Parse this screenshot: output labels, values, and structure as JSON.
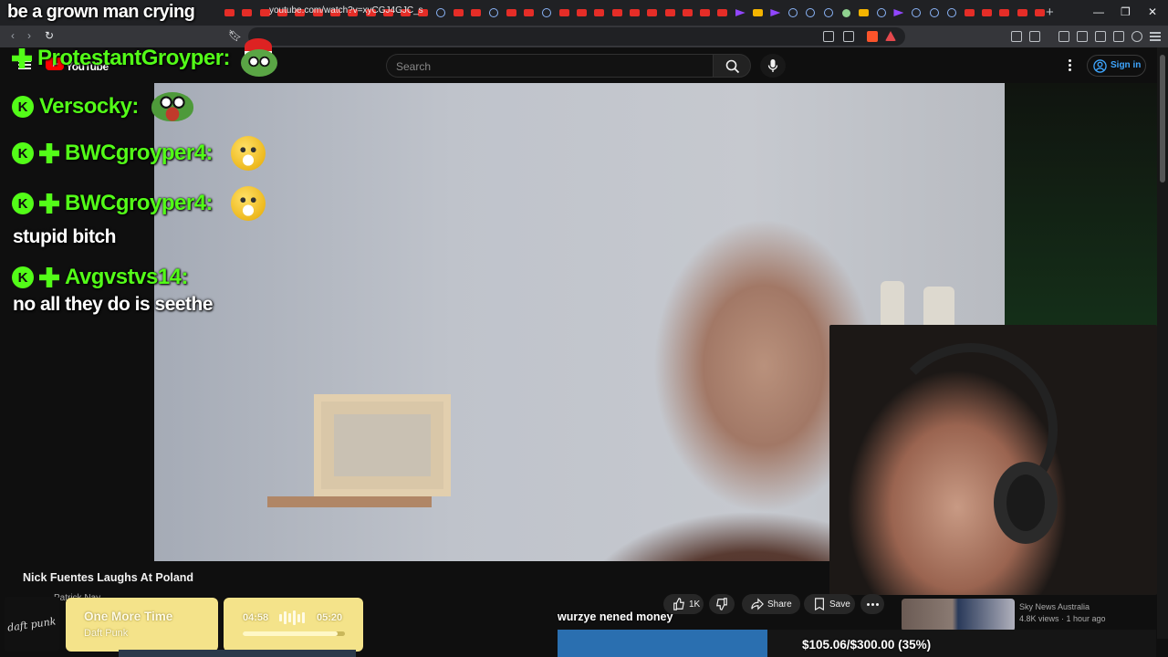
{
  "browser": {
    "url": "youtube.com/watch?v=xyCGJ4GJC_s",
    "new_tab_glyph": "+",
    "window_controls": [
      "—",
      "❐",
      "✕"
    ]
  },
  "youtube": {
    "logo_text": "YouTube",
    "search_placeholder": "Search",
    "sign_in_label": "Sign in",
    "video_title": "Nick Fuentes Laughs At Poland",
    "channel_name": "Patrick Nay",
    "like_count": "1K",
    "share_label": "Share",
    "save_label": "Save",
    "recommended": {
      "channel": "Sky News Australia",
      "meta": "4.8K views · 1 hour ago"
    }
  },
  "overlay": {
    "top_caption": "be a grown man crying",
    "chat": [
      {
        "user": "ProtestantGroyper:",
        "badges": [
          "plus"
        ],
        "emote": "santa-frog-emote",
        "message": ""
      },
      {
        "user": "Versocky:",
        "badges": [
          "kick"
        ],
        "emote": "frog-emote",
        "message": ""
      },
      {
        "user": "BWCgroyper4:",
        "badges": [
          "kick",
          "plus"
        ],
        "emote": "angry-emote",
        "message": ""
      },
      {
        "user": "BWCgroyper4:",
        "badges": [
          "kick",
          "plus"
        ],
        "emote": "angry-emote",
        "message": "stupid bitch"
      },
      {
        "user": "Avgvstvs14:",
        "badges": [
          "kick",
          "plus"
        ],
        "emote": "",
        "message": "no all they do is seethe"
      }
    ],
    "kick_badge_glyph": "K",
    "now_playing": {
      "album_text": "daft punk",
      "title": "One More Time",
      "artist": "Daft Punk",
      "elapsed": "04:58",
      "duration": "05:20",
      "progress_fraction": 0.93
    },
    "donation_message": "wurzye nened money",
    "goal": {
      "label": "$105.06/$300.00 (35%)",
      "fraction": 0.35
    }
  },
  "colors": {
    "kick_green": "#53fc18",
    "youtube_red": "#ff0000",
    "link_blue": "#3ea6ff",
    "now_playing_yellow": "#f4e38a",
    "goal_blue": "#2a6fb0"
  }
}
